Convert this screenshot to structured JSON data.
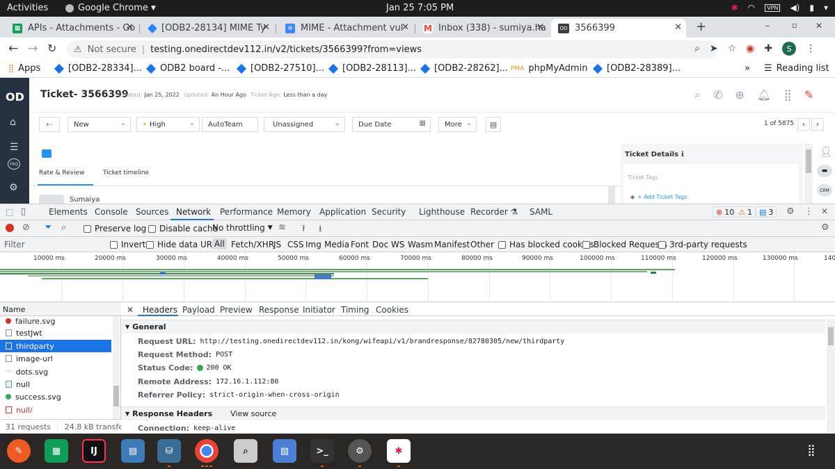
{
  "system": {
    "activities": "Activities",
    "app_name": "Google Chrome",
    "clock": "Jan 25   7:05 PM"
  },
  "tabs": [
    {
      "label": "APIs - Attachments - Go",
      "color": "#0f9d58"
    },
    {
      "label": "[ODB2-28134] MIME Ty",
      "color": "#2684ff"
    },
    {
      "label": "MIME - Attachment vul",
      "color": "#4285f4"
    },
    {
      "label": "Inbox (338) - sumiya.ha",
      "color": "#ea4335"
    },
    {
      "label": "3566399",
      "color": "#3c4043",
      "active": true
    }
  ],
  "address": {
    "security": "Not secure",
    "url": "testing.onedirectdev112.in/v2/tickets/3566399?from=views",
    "profile": "S"
  },
  "bookmarks": {
    "apps": "Apps",
    "items": [
      "[ODB2-28334]...",
      "ODB2 board -...",
      "[ODB2-27510]...",
      "[ODB2-28113]...",
      "[ODB2-28262]...",
      "phpMyAdmin",
      "[ODB2-28389]..."
    ],
    "more": "»",
    "reading_list": "Reading list"
  },
  "app": {
    "logo": "OD",
    "title": "Ticket- 3566399",
    "meta": {
      "created_label": "Created:",
      "created": "Jan 25, 2022",
      "updated_label": "Updated:",
      "updated": "An Hour Ago",
      "age_label": "Ticket Age:",
      "age": "Less than a day"
    },
    "filters": {
      "status": "New",
      "priority": "High",
      "team": "AutoTeam",
      "assignee": "Unassigned",
      "due_date": "Due Date",
      "more": "More"
    },
    "pager": "1 of 5875",
    "subtabs": [
      "Rate & Review",
      "Ticket timeline"
    ],
    "customer": "Sumaiya",
    "right_panel": {
      "title": "Ticket Details",
      "tags_label": "Ticket Tags",
      "add_tags": "+ Add Ticket Tags"
    }
  },
  "devtools": {
    "tabs": [
      "Elements",
      "Console",
      "Sources",
      "Network",
      "Performance",
      "Memory",
      "Application",
      "Security",
      "Lighthouse",
      "Recorder",
      "SAML"
    ],
    "errors": "10",
    "warnings": "1",
    "messages": "3",
    "toolbar": {
      "preserve_log": "Preserve log",
      "disable_cache": "Disable cache",
      "throttling": "No throttling"
    },
    "filter": {
      "placeholder": "Filter",
      "invert": "Invert",
      "hide_data_urls": "Hide data URLs",
      "types": [
        "All",
        "Fetch/XHR",
        "JS",
        "CSS",
        "Img",
        "Media",
        "Font",
        "Doc",
        "WS",
        "Wasm",
        "Manifest",
        "Other"
      ],
      "blocked_cookies": "Has blocked cookies",
      "blocked_requests": "Blocked Requests",
      "third_party": "3rd-party requests"
    },
    "timeline_ticks": [
      "10000 ms",
      "20000 ms",
      "30000 ms",
      "40000 ms",
      "50000 ms",
      "60000 ms",
      "70000 ms",
      "80000 ms",
      "90000 ms",
      "100000 ms",
      "110000 ms",
      "120000 ms",
      "130000 ms",
      "140"
    ],
    "requests": {
      "header": "Name",
      "items": [
        {
          "name": "failure.svg",
          "kind": "red"
        },
        {
          "name": "testJwt",
          "kind": "doc"
        },
        {
          "name": "thirdparty",
          "kind": "doc",
          "selected": true
        },
        {
          "name": "image-url",
          "kind": "doc"
        },
        {
          "name": "dots.svg",
          "kind": "dots"
        },
        {
          "name": "null",
          "kind": "doc"
        },
        {
          "name": "success.svg",
          "kind": "green"
        },
        {
          "name": "null/",
          "kind": "err"
        }
      ],
      "count": "31 requests",
      "transferred": "24.8 kB transferrec"
    },
    "detail_tabs": [
      "Headers",
      "Payload",
      "Preview",
      "Response",
      "Initiator",
      "Timing",
      "Cookies"
    ],
    "general": {
      "title": "General",
      "request_url_label": "Request URL:",
      "request_url": "http://testing.onedirectdev112.in/kong/wifeapi/v1/brandresponse/82780305/new/thirdparty",
      "method_label": "Request Method:",
      "method": "POST",
      "status_label": "Status Code:",
      "status": "200 OK",
      "remote_label": "Remote Address:",
      "remote": "172.16.1.112:80",
      "referrer_label": "Referrer Policy:",
      "referrer": "strict-origin-when-cross-origin"
    },
    "response_headers": {
      "title": "Response Headers",
      "view_source": "View source",
      "connection_label": "Connection:",
      "connection": "keep-alive"
    }
  },
  "dock": {
    "apps": [
      "Postman",
      "Sheets",
      "IntelliJ",
      "Files",
      "MySQL",
      "Chrome",
      "Search",
      "Docs",
      "Terminal",
      "Settings",
      "Slack"
    ]
  }
}
